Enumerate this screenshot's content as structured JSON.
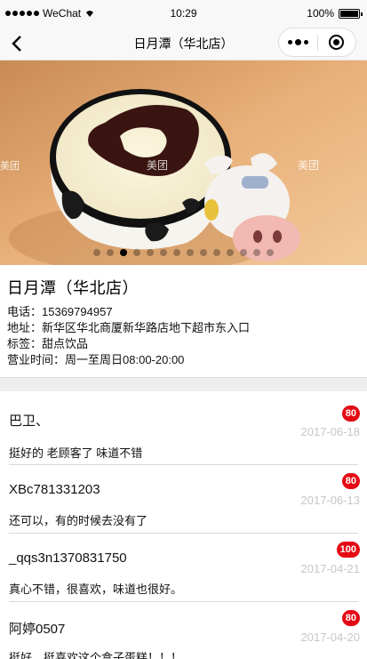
{
  "status_bar": {
    "carrier": "WeChat",
    "time": "10:29",
    "battery": "100%"
  },
  "nav": {
    "title": "日月潭（华北店）"
  },
  "banner": {
    "slide_count": 14,
    "active_index": 2,
    "watermark": "美团"
  },
  "shop": {
    "name": "日月潭（华北店）",
    "phone_label": "电话：",
    "phone": "15369794957",
    "address_label": "地址：",
    "address": "新华区华北商厦新华路店地下超市东入口",
    "tag_label": "标签：",
    "tag": "甜点饮品",
    "hours_label": "营业时间：",
    "hours": "周一至周日08:00-20:00"
  },
  "reviews": [
    {
      "user": "巴卫、",
      "score": "80",
      "date": "2017-06-18",
      "text": "挺好的 老顾客了 味道不错"
    },
    {
      "user": "XBc781331203",
      "score": "80",
      "date": "2017-06-13",
      "text": "还可以，有的时候去没有了"
    },
    {
      "user": "_qqs3n1370831750",
      "score": "100",
      "date": "2017-04-21",
      "text": "真心不错，很喜欢，味道也很好。"
    },
    {
      "user": "阿婷0507",
      "score": "80",
      "date": "2017-04-20",
      "text": "挺好，挺喜欢这个盒子蛋糕！！！"
    }
  ],
  "colors": {
    "badge": "#e50914",
    "date": "#c7c7c7",
    "divider": "#eeeeee"
  }
}
